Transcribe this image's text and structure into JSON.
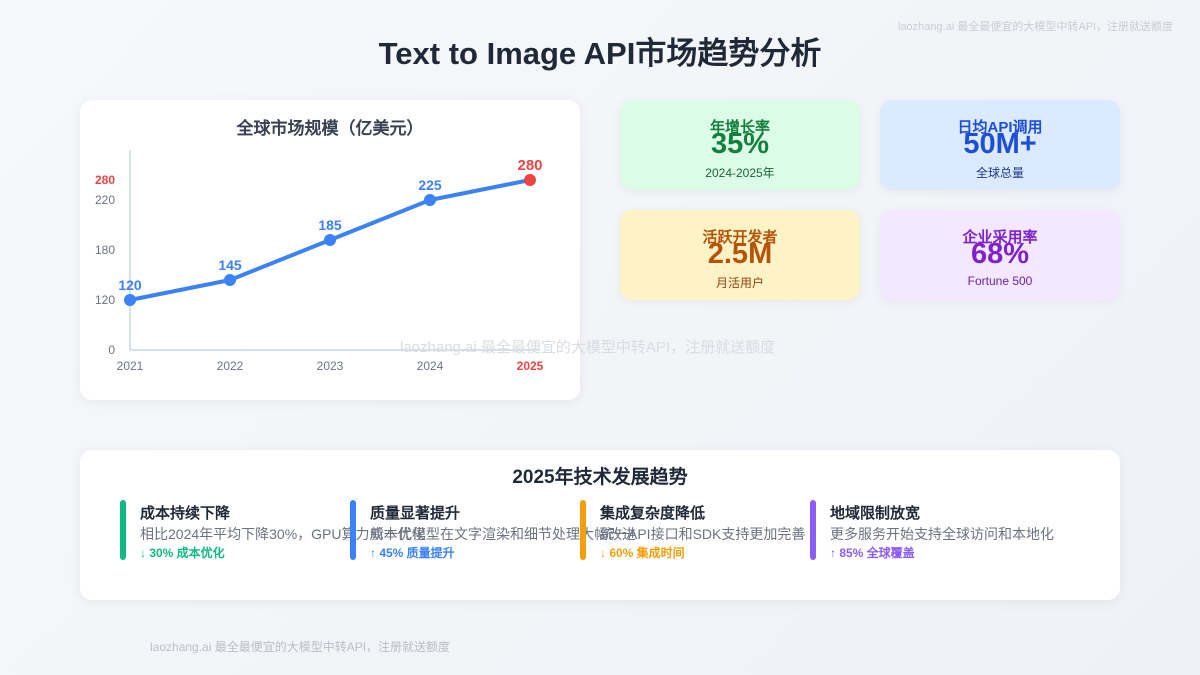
{
  "page": {
    "title": "Text to Image API市场趋势分析",
    "watermark_top": "laozhang.ai 最全最便宜的大模型中转API，注册就送额度",
    "watermark_mid": "laozhang.ai 最全最便宜的大模型中转API，注册就送额度",
    "watermark_bottom": "laozhang.ai 最全最便宜的大模型中转API，注册就送额度"
  },
  "chart_data": {
    "type": "line",
    "title": "全球市场规模（亿美元）",
    "categories": [
      "2021",
      "2022",
      "2023",
      "2024",
      "2025"
    ],
    "values": [
      120,
      145,
      185,
      225,
      280
    ],
    "y_ticks": [
      "0",
      "120",
      "180",
      "220",
      "280"
    ],
    "highlight_last": true,
    "colors": {
      "line": "#3b82f6",
      "highlight": "#ef4444",
      "axis": "#cbd5e1",
      "tick": "#6b7280"
    }
  },
  "stats": [
    {
      "label": "年增长率",
      "value": "35%",
      "sub": "2024-2025年",
      "bg": "#dcfce7",
      "fg": "#15803d",
      "sub_color": "#166534"
    },
    {
      "label": "日均API调用",
      "value": "50M+",
      "sub": "全球总量",
      "bg": "#dbeafe",
      "fg": "#1d4ed8",
      "sub_color": "#1e3a8a"
    },
    {
      "label": "活跃开发者",
      "value": "2.5M",
      "sub": "月活用户",
      "bg": "#fef3c7",
      "fg": "#b45309",
      "sub_color": "#92400e"
    },
    {
      "label": "企业采用率",
      "value": "68%",
      "sub": "Fortune 500",
      "bg": "#f3e8ff",
      "fg": "#7e22ce",
      "sub_color": "#6b21a8"
    }
  ],
  "trends": {
    "title": "2025年技术发展趋势",
    "items": [
      {
        "title": "成本持续下降",
        "desc": "相比2024年平均下降30%，GPU算力成本优化",
        "metric": "↓ 30% 成本优化",
        "color": "#10b981"
      },
      {
        "title": "质量显著提升",
        "desc": "新一代模型在文字渲染和细节处理大幅改进",
        "metric": "↑ 45% 质量提升",
        "color": "#3b82f6"
      },
      {
        "title": "集成复杂度降低",
        "desc": "统一API接口和SDK支持更加完善",
        "metric": "↓ 60% 集成时间",
        "color": "#f59e0b"
      },
      {
        "title": "地域限制放宽",
        "desc": "更多服务开始支持全球访问和本地化",
        "metric": "↑ 85% 全球覆盖",
        "color": "#8b5cf6"
      }
    ]
  }
}
